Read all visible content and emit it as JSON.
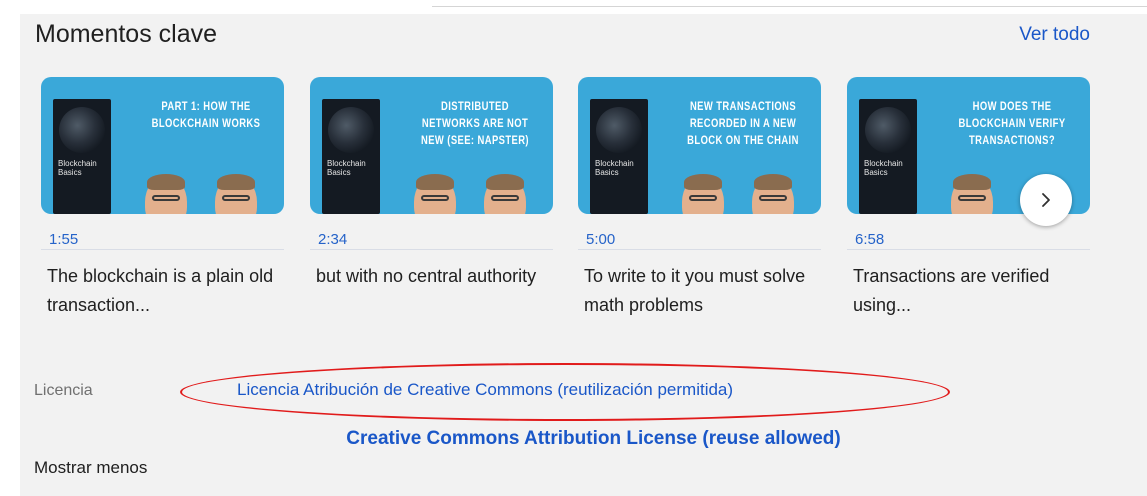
{
  "section": {
    "title": "Momentos clave",
    "see_all": "Ver todo"
  },
  "cards": [
    {
      "thumb_title": "PART 1: HOW THE BLOCKCHAIN WORKS",
      "book_title": "Blockchain Basics",
      "time": "1:55",
      "caption": "The blockchain is a plain old transaction..."
    },
    {
      "thumb_title": "DISTRIBUTED NETWORKS ARE NOT NEW (SEE: NAPSTER)",
      "book_title": "Blockchain Basics",
      "time": "2:34",
      "caption": "but with no central authority"
    },
    {
      "thumb_title": "NEW TRANSACTIONS RECORDED IN A NEW BLOCK ON THE CHAIN",
      "book_title": "Blockchain Basics",
      "time": "5:00",
      "caption": "To write to it you must solve math problems"
    },
    {
      "thumb_title": "HOW DOES THE BLOCKCHAIN VERIFY TRANSACTIONS?",
      "book_title": "Blockchain Basics",
      "time": "6:58",
      "caption": "Transactions are verified using..."
    }
  ],
  "next_button": {
    "icon": "chevron-right-icon"
  },
  "license": {
    "label": "Licencia",
    "link": "Licencia Atribución de Creative Commons (reutilización permitida)",
    "translation": "Creative Commons Attribution License (reuse allowed)"
  },
  "show_less": "Mostrar menos",
  "colors": {
    "link": "#1a57c8",
    "thumb_bg": "#3aa8d9",
    "panel_bg": "#f2f2f2",
    "annotation": "#e11b1b"
  }
}
